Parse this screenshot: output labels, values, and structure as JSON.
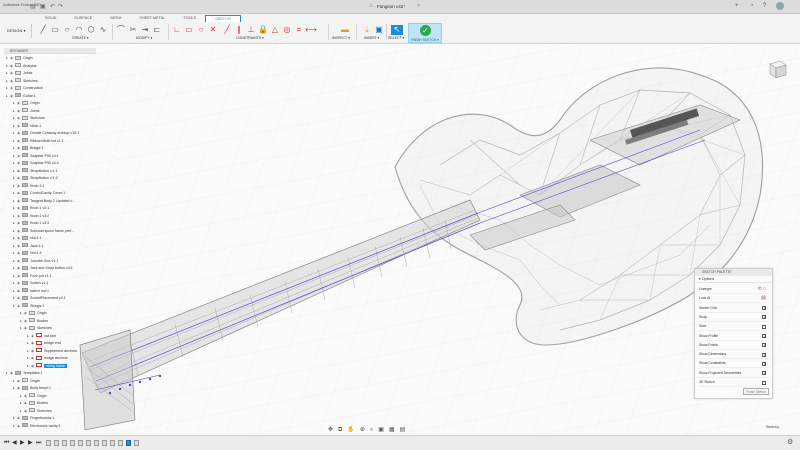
{
  "app": {
    "title": "Autodesk Fusion 360",
    "document_title": "Fangeon v42*"
  },
  "ribbon": {
    "tabs": [
      "SOLID",
      "SURFACE",
      "MESH",
      "SHEET METAL",
      "TOOLS",
      "SKETCH"
    ],
    "active_tab": "SKETCH",
    "workspace": "DESIGN ▾",
    "groups": {
      "create": "CREATE ▾",
      "modify": "MODIFY ▾",
      "constraints": "CONSTRAINTS ▾",
      "inspect": "INSPECT ▾",
      "insert": "INSERT ▾",
      "select": "SELECT ▾",
      "finish_sketch": "FINISH SKETCH ▾"
    }
  },
  "browser": {
    "header": "BROWSER",
    "items": [
      {
        "label": "Origin",
        "indent": 0,
        "icon": "folder"
      },
      {
        "label": "Analysis",
        "indent": 0,
        "icon": "folder"
      },
      {
        "label": "Joints",
        "indent": 0,
        "icon": "folder"
      },
      {
        "label": "Sketches",
        "indent": 0,
        "icon": "folder"
      },
      {
        "label": "Construction",
        "indent": 0,
        "icon": "folder"
      },
      {
        "label": "Guitar:1",
        "indent": 0,
        "icon": "body"
      },
      {
        "label": "Origin",
        "indent": 1,
        "icon": "folder"
      },
      {
        "label": "Joints",
        "indent": 1,
        "icon": "folder"
      },
      {
        "label": "Sketches",
        "indent": 1,
        "icon": "folder"
      },
      {
        "label": "Neck:1",
        "indent": 1,
        "icon": "body"
      },
      {
        "label": "Double Cutaway archtop v10:1",
        "indent": 1,
        "icon": "body"
      },
      {
        "label": "Ribbon:Multi:hot v1:1",
        "indent": 1,
        "icon": "body"
      },
      {
        "label": "Bridge:1",
        "indent": 1,
        "icon": "body"
      },
      {
        "label": "Soapbar P90 v4:1",
        "indent": 1,
        "icon": "link"
      },
      {
        "label": "Soapbar P90 v4:2",
        "indent": 1,
        "icon": "link"
      },
      {
        "label": "StrapButton v:1:1",
        "indent": 1,
        "icon": "link"
      },
      {
        "label": "StrapButton v:1:2",
        "indent": 1,
        "icon": "link"
      },
      {
        "label": "Knob:1:1",
        "indent": 1,
        "icon": "body"
      },
      {
        "label": "ControlCavity Cover:1",
        "indent": 1,
        "icon": "body"
      },
      {
        "label": "Tangent Body 2 Updated v...",
        "indent": 1,
        "icon": "link"
      },
      {
        "label": "Knob:1 v3:1",
        "indent": 1,
        "icon": "body"
      },
      {
        "label": "Knob:1 v3:2",
        "indent": 1,
        "icon": "body"
      },
      {
        "label": "Knob:1 v3:3",
        "indent": 1,
        "icon": "body"
      },
      {
        "label": "Sonuvarrsjonic frame pref...",
        "indent": 1,
        "icon": "link"
      },
      {
        "label": "Nut:1:1",
        "indent": 1,
        "icon": "body"
      },
      {
        "label": "Jack:1:1",
        "indent": 1,
        "icon": "body"
      },
      {
        "label": "Nut:1:4",
        "indent": 1,
        "icon": "body"
      },
      {
        "label": "Junction Box v1:1",
        "indent": 1,
        "icon": "link"
      },
      {
        "label": "Jack and Strap button v3:1",
        "indent": 1,
        "icon": "link"
      },
      {
        "label": "Fuzz pot v1:1",
        "indent": 1,
        "icon": "link"
      },
      {
        "label": "Switch v1:1",
        "indent": 1,
        "icon": "link"
      },
      {
        "label": "switch nut:1",
        "indent": 1,
        "icon": "body"
      },
      {
        "label": "SocketPlacement v2:1",
        "indent": 1,
        "icon": "link"
      },
      {
        "label": "Strings:1",
        "indent": 1,
        "icon": "body"
      },
      {
        "label": "Origin",
        "indent": 2,
        "icon": "folder"
      },
      {
        "label": "Bodies",
        "indent": 2,
        "icon": "folder"
      },
      {
        "label": "Sketches",
        "indent": 2,
        "icon": "folder"
      },
      {
        "label": "nut slot",
        "indent": 3,
        "icon": "sketch"
      },
      {
        "label": "bridge end",
        "indent": 3,
        "icon": "sketch"
      },
      {
        "label": "Supplement anchors",
        "indent": 3,
        "icon": "sketch"
      },
      {
        "label": "bridge anchors",
        "indent": 3,
        "icon": "sketch"
      },
      {
        "label": "string frame",
        "indent": 3,
        "icon": "sketch",
        "selected": true
      },
      {
        "label": "Templates:1",
        "indent": 0,
        "icon": "body"
      },
      {
        "label": "Origin",
        "indent": 1,
        "icon": "folder"
      },
      {
        "label": "Body templ:1",
        "indent": 1,
        "icon": "body"
      },
      {
        "label": "Origin",
        "indent": 2,
        "icon": "folder"
      },
      {
        "label": "Bodies",
        "indent": 2,
        "icon": "folder"
      },
      {
        "label": "Sketches",
        "indent": 2,
        "icon": "folder"
      },
      {
        "label": "Fingerboards:1",
        "indent": 1,
        "icon": "body"
      },
      {
        "label": "Electronics cavity:1",
        "indent": 1,
        "icon": "body"
      }
    ]
  },
  "palette": {
    "header": "SKETCH PALETTE",
    "section": "Options",
    "rows": [
      {
        "label": "Linetype",
        "type": "icons"
      },
      {
        "label": "Look At",
        "type": "icon"
      },
      {
        "label": "Sketch Grid",
        "type": "checkbox",
        "checked": true
      },
      {
        "label": "Snap",
        "type": "checkbox",
        "checked": true
      },
      {
        "label": "Slice",
        "type": "checkbox",
        "checked": false
      },
      {
        "label": "Show Profile",
        "type": "checkbox",
        "checked": true
      },
      {
        "label": "Show Points",
        "type": "checkbox",
        "checked": true
      },
      {
        "label": "Show Dimensions",
        "type": "checkbox",
        "checked": true
      },
      {
        "label": "Show Constraints",
        "type": "checkbox",
        "checked": true
      },
      {
        "label": "Show Projected Geometries",
        "type": "checkbox",
        "checked": true
      },
      {
        "label": "3D Sketch",
        "type": "checkbox",
        "checked": false
      }
    ],
    "finish_button": "Finish Sketch"
  },
  "status": {
    "corner_label": "Sketch ▸"
  },
  "timeline": {
    "items": 12,
    "highlighted_index": 10
  },
  "icons": [
    "file-icon",
    "save-icon",
    "undo-icon",
    "redo-icon",
    "close-icon",
    "notification-icon",
    "help-icon",
    "user-icon",
    "viewcube-icon",
    "orbit-icon",
    "pan-icon",
    "zoom-icon",
    "fit-icon",
    "display-settings-icon",
    "grid-icon",
    "play-icon",
    "settings-icon"
  ],
  "colors": {
    "accent": "#1c8ed8",
    "finish_bg": "#bfe4f6",
    "finish_check": "#2aa84a",
    "selection": "#1a8fd8"
  }
}
